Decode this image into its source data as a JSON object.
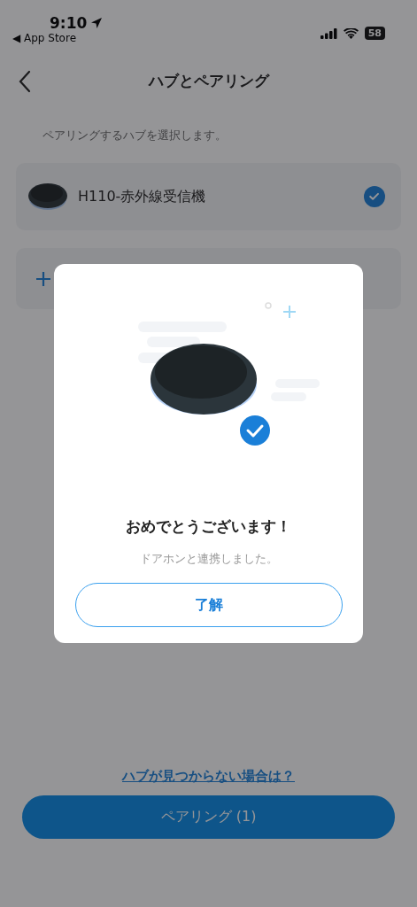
{
  "status_bar": {
    "time": "9:10",
    "back_app": "◀ App Store",
    "battery": "58"
  },
  "nav": {
    "title": "ハブとペアリング"
  },
  "subtitle": "ペアリングするハブを選択します。",
  "hubs": [
    {
      "name": "H110-赤外線受信機",
      "selected": true
    }
  ],
  "help_link": "ハブが見つからない場合は？",
  "pair_button": "ペアリング (1)",
  "dialog": {
    "title": "おめでとうございます！",
    "message": "ドアホンと連携しました。",
    "button": "了解"
  }
}
